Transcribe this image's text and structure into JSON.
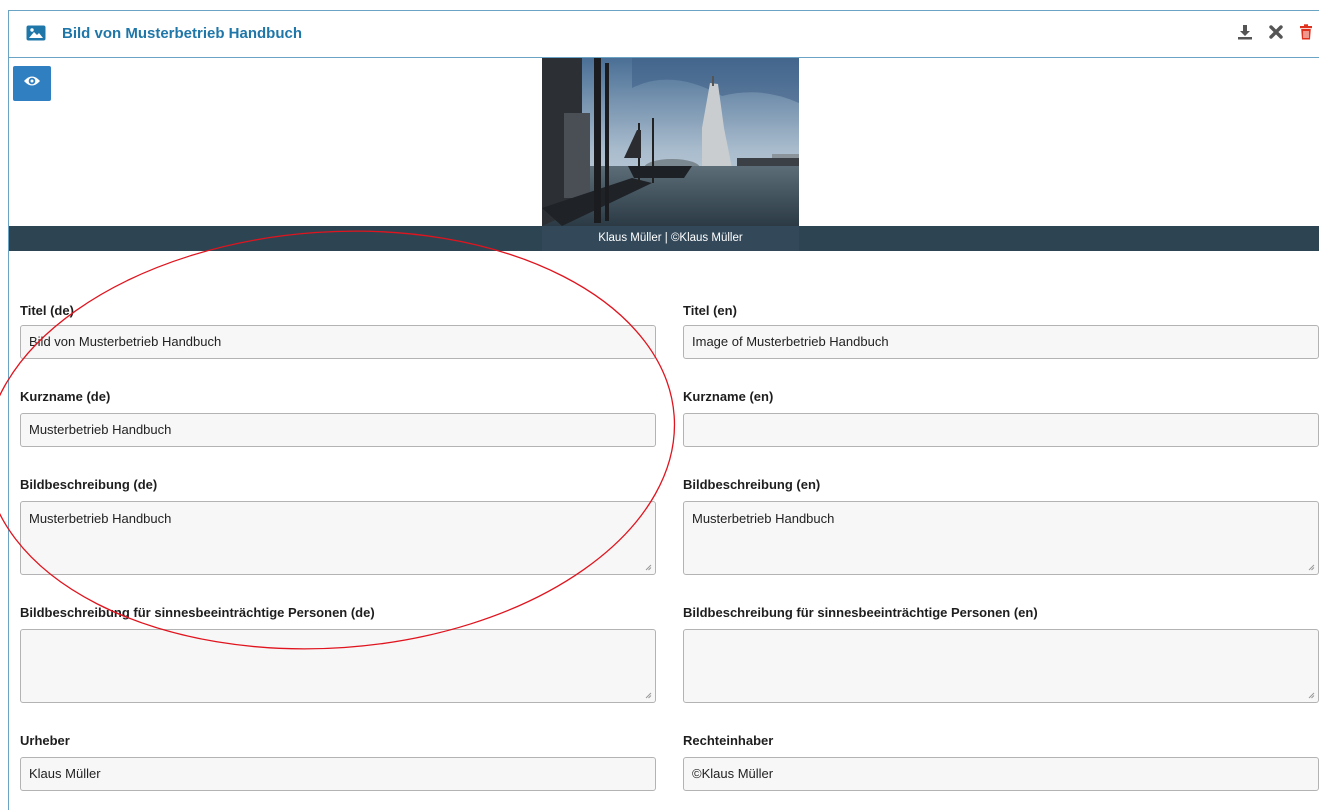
{
  "header": {
    "title": "Bild von Musterbetrieb Handbuch",
    "icon": "image-icon",
    "actions": [
      "download-icon",
      "close-icon",
      "trash-icon"
    ],
    "colors": {
      "title": "#1f77a9",
      "delete": "#e0301e"
    }
  },
  "preview": {
    "eye_icon": "eye-icon",
    "caption": "Klaus Müller | ©Klaus Müller"
  },
  "fields": {
    "titel_de": {
      "label": "Titel (de)",
      "value": "Bild von Musterbetrieb Handbuch"
    },
    "titel_en": {
      "label": "Titel (en)",
      "value": "Image of Musterbetrieb Handbuch"
    },
    "kurzname_de": {
      "label": "Kurzname (de)",
      "value": "Musterbetrieb Handbuch"
    },
    "kurzname_en": {
      "label": "Kurzname (en)",
      "value": ""
    },
    "beschreibung_de": {
      "label": "Bildbeschreibung (de)",
      "value": "Musterbetrieb Handbuch"
    },
    "beschreibung_en": {
      "label": "Bildbeschreibung (en)",
      "value": "Musterbetrieb Handbuch"
    },
    "barrierefrei_de": {
      "label": "Bildbeschreibung für sinnesbeeinträchtige Personen (de)",
      "value": ""
    },
    "barrierefrei_en": {
      "label": "Bildbeschreibung für sinnesbeeinträchtige Personen (en)",
      "value": ""
    },
    "urheber": {
      "label": "Urheber",
      "value": "Klaus Müller"
    },
    "rechteinhaber": {
      "label": "Rechteinhaber",
      "value": "©Klaus Müller"
    }
  },
  "annotation": {
    "shape": "ellipse",
    "color": "#e0141e"
  }
}
